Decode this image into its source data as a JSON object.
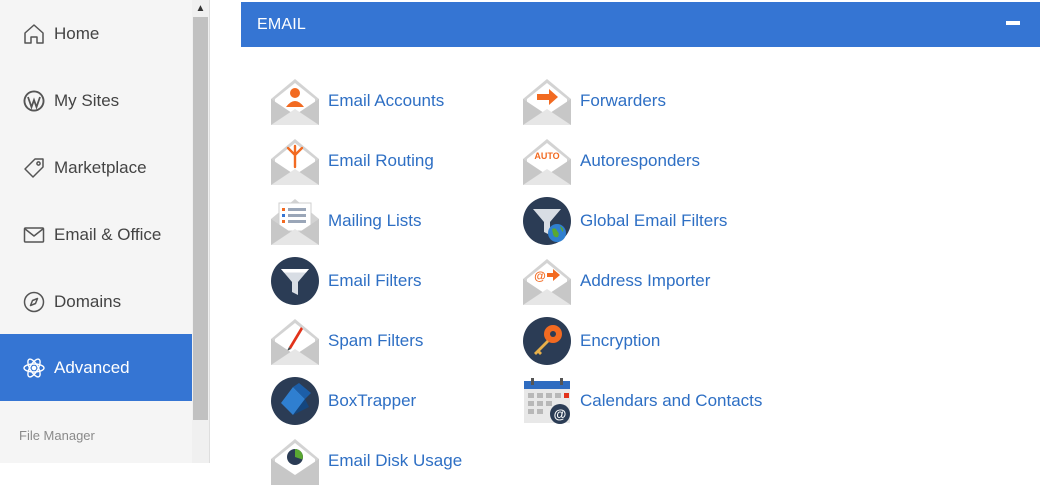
{
  "sidebar": {
    "items": [
      {
        "label": "Home",
        "icon": "home-icon"
      },
      {
        "label": "My Sites",
        "icon": "wordpress-icon"
      },
      {
        "label": "Marketplace",
        "icon": "tag-icon"
      },
      {
        "label": "Email & Office",
        "icon": "envelope-icon"
      },
      {
        "label": "Domains",
        "icon": "compass-icon"
      },
      {
        "label": "Advanced",
        "icon": "atom-icon",
        "active": true
      }
    ],
    "sub_label": "File Manager"
  },
  "email_section": {
    "title": "EMAIL",
    "tools": [
      {
        "label": "Email Accounts",
        "icon": "email-accounts-icon"
      },
      {
        "label": "Forwarders",
        "icon": "forwarders-icon"
      },
      {
        "label": "Email Routing",
        "icon": "email-routing-icon"
      },
      {
        "label": "Autoresponders",
        "icon": "autoresponders-icon",
        "icon_text": "AUTO"
      },
      {
        "label": "Mailing Lists",
        "icon": "mailing-lists-icon"
      },
      {
        "label": "Global Email Filters",
        "icon": "global-email-filters-icon"
      },
      {
        "label": "Email Filters",
        "icon": "email-filters-icon"
      },
      {
        "label": "Address Importer",
        "icon": "address-importer-icon",
        "icon_text": "@"
      },
      {
        "label": "Spam Filters",
        "icon": "spam-filters-icon"
      },
      {
        "label": "Encryption",
        "icon": "encryption-icon"
      },
      {
        "label": "BoxTrapper",
        "icon": "boxtrapper-icon"
      },
      {
        "label": "Calendars and Contacts",
        "icon": "calendars-contacts-icon"
      },
      {
        "label": "Email Disk Usage",
        "icon": "email-disk-usage-icon"
      }
    ]
  },
  "colors": {
    "accent": "#3575d3",
    "link": "#2e6fc4",
    "orange": "#f26a21",
    "navy": "#2b3c55"
  }
}
